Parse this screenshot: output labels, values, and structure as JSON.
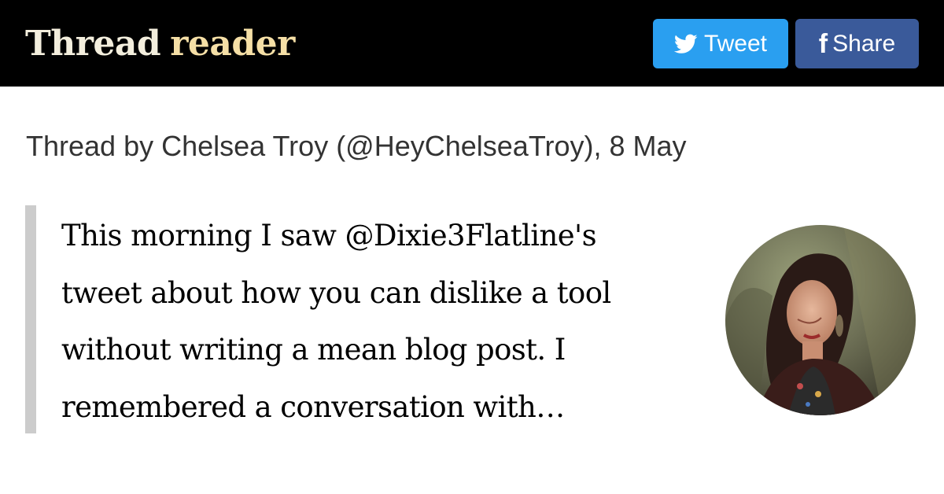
{
  "header": {
    "brand_primary": "Thread",
    "brand_secondary": "reader",
    "tweet_button_label": "Tweet",
    "share_button_label": "Share",
    "tweet_icon": "twitter-bird-icon",
    "share_icon": "facebook-f-icon",
    "share_icon_glyph": "f",
    "colors": {
      "background": "#000000",
      "tweet_button": "#2a9ff0",
      "share_button": "#3a5a9a"
    }
  },
  "byline": "Thread by Chelsea Troy (@HeyChelseaTroy), 8 May",
  "tweet": {
    "lines": [
      "This morning I saw @Dixie3Flatline's",
      "tweet about how you can dislike a tool",
      "without writing a mean blog post. I",
      "remembered a conversation with…"
    ]
  }
}
